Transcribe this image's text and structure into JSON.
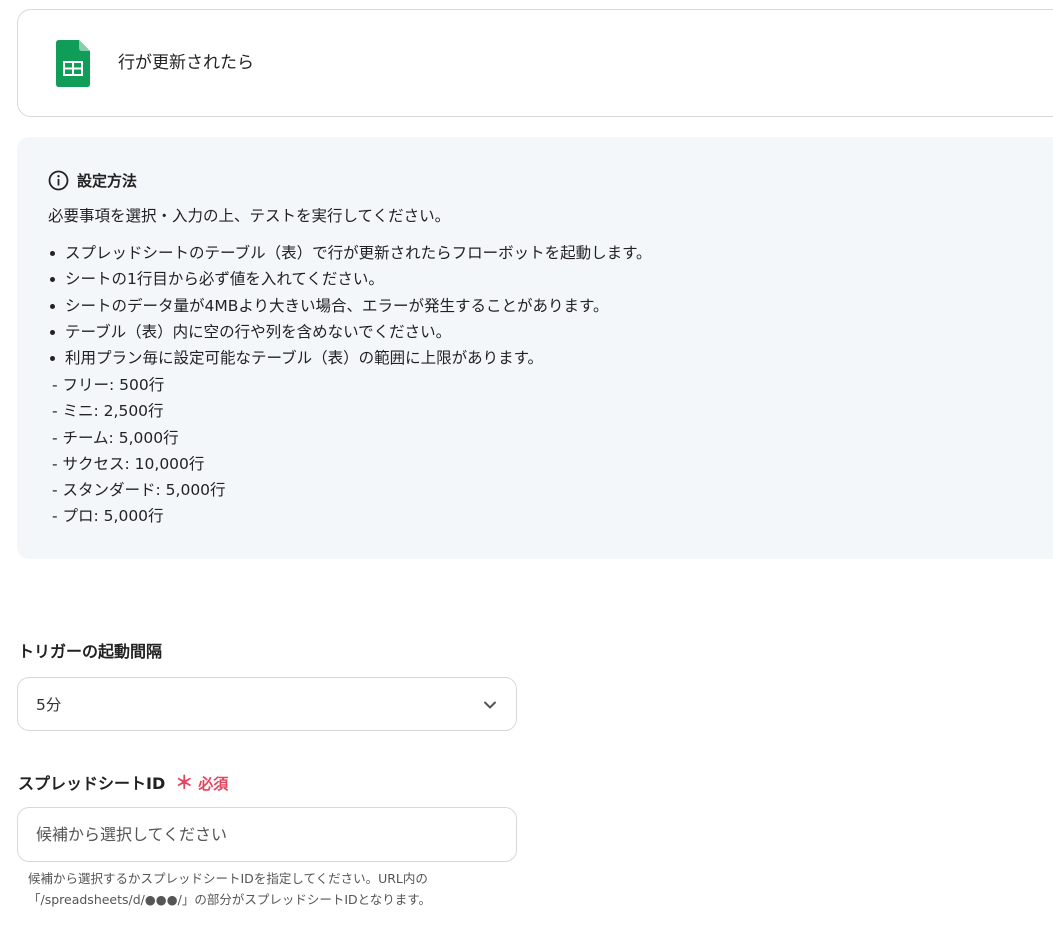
{
  "trigger": {
    "title": "行が更新されたら",
    "icon": "google-sheets-icon",
    "icon_color": "#0f9d58"
  },
  "info": {
    "heading": "設定方法",
    "intro": "必要事項を選択・入力の上、テストを実行してください。",
    "bullets": [
      "スプレッドシートのテーブル（表）で行が更新されたらフローボットを起動します。",
      "シートの1行目から必ず値を入れてください。",
      "シートのデータ量が4MBより大きい場合、エラーが発生することがあります。",
      "テーブル（表）内に空の行や列を含めないでください。",
      "利用プラン毎に設定可能なテーブル（表）の範囲に上限があります。"
    ],
    "plans": [
      "- フリー: 500行",
      "- ミニ: 2,500行",
      "- チーム: 5,000行",
      "- サクセス: 10,000行",
      "- スタンダード: 5,000行",
      "- プロ: 5,000行"
    ]
  },
  "interval": {
    "label": "トリガーの起動間隔",
    "value": "5分"
  },
  "spreadsheet": {
    "label": "スプレッドシートID",
    "required_star": "＊",
    "required_label": "必須",
    "required_color": "#e2455e",
    "placeholder": "候補から選択してください",
    "help_line1": "候補から選択するかスプレッドシートIDを指定してください。URL内の",
    "help_line2": "「/spreadsheets/d/●●●/」の部分がスプレッドシートIDとなります。"
  }
}
